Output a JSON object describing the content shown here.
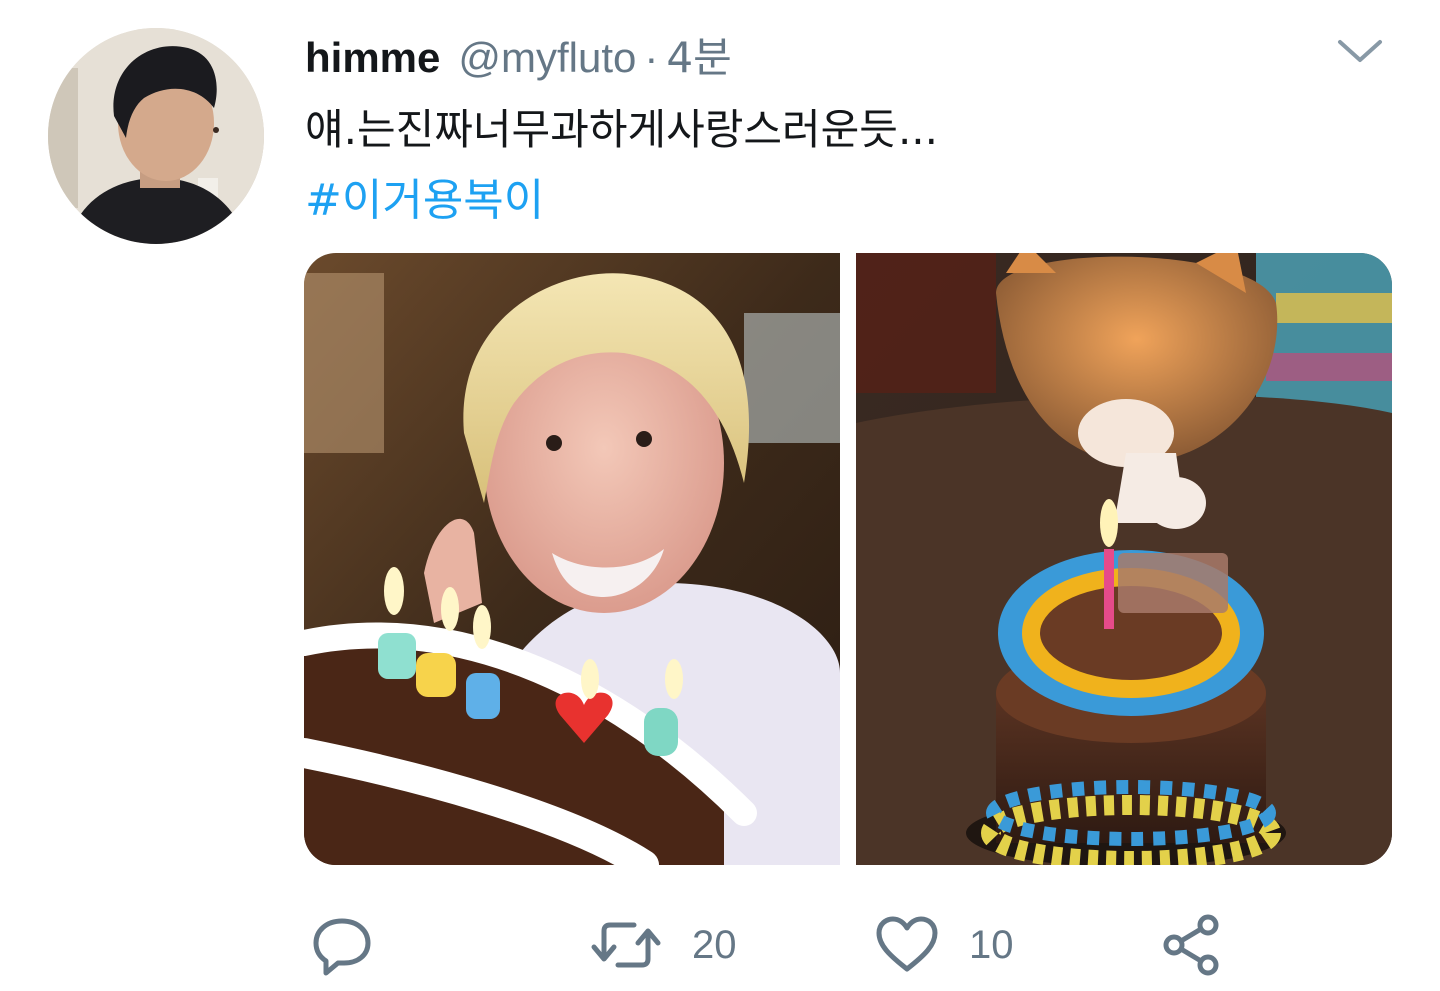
{
  "tweet": {
    "display_name": "himme",
    "handle": "@myfluto",
    "separator": "·",
    "timestamp": "4분",
    "text": "얘.는진짜너무과하게사랑스러운듯...",
    "hashtag": "#이거용복이"
  },
  "media": {
    "photo1_icon": "birthday-selfie-photo",
    "photo2_icon": "cat-birthday-cake-photo"
  },
  "actions": {
    "reply_count": "",
    "retweet_count": "20",
    "like_count": "10"
  },
  "colors": {
    "accent": "#1da1f2",
    "secondary_text": "#657786",
    "primary_text": "#14171a"
  }
}
